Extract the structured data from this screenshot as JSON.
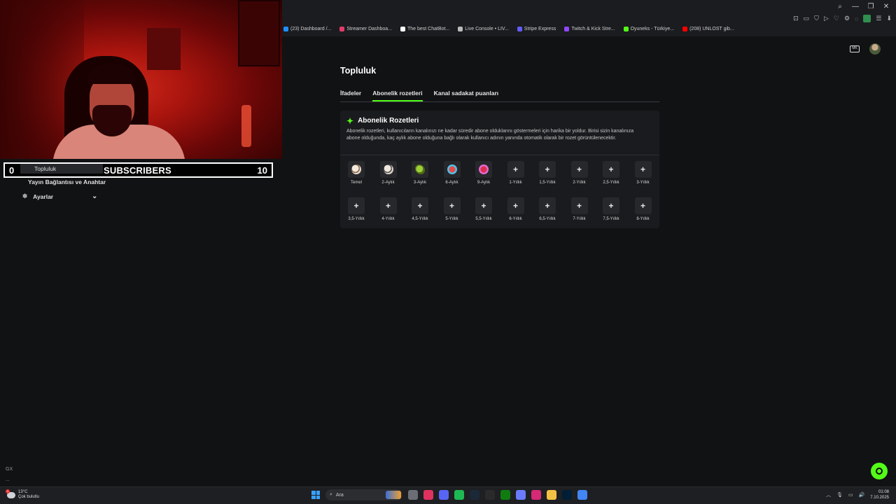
{
  "browser": {
    "bookmarks": [
      {
        "label": "(23) Dashboard /...",
        "color": "#1f8fff"
      },
      {
        "label": "Streamer Dashboa...",
        "color": "#e23b6b"
      },
      {
        "label": "The best ChatBot...",
        "color": "#ffffff"
      },
      {
        "label": "Live Console • LIV...",
        "color": "#bbbbbb"
      },
      {
        "label": "Stripe Express",
        "color": "#635bff"
      },
      {
        "label": "Twitch & Kick Stre...",
        "color": "#9147ff"
      },
      {
        "label": "Oyuneks - Türkiye...",
        "color": "#53fc18"
      },
      {
        "label": "(208) UNLOST gib...",
        "color": "#ff0000"
      }
    ],
    "extension_badge": "8"
  },
  "overlay": {
    "left_count": "0",
    "label": "SUBSCRIBERS",
    "right_count": "10",
    "covered_tab_label": "Topluluk"
  },
  "sidebar": {
    "stream_link": "Yayın Bağlantısı ve Anahtar",
    "settings_label": "Ayarlar",
    "bottom_a": "GX",
    "bottom_b": "..."
  },
  "header": {
    "icon_box_text": "MK"
  },
  "page": {
    "title": "Topluluk",
    "tabs": [
      {
        "label": "İfadeler",
        "active": false
      },
      {
        "label": "Abonelik rozetleri",
        "active": true
      },
      {
        "label": "Kanal sadakat puanları",
        "active": false
      }
    ],
    "card": {
      "title": "Abonelik Rozetleri",
      "description": "Abonelik rozetleri, kullanıcıların kanalınızı ne kadar süredir abone olduklarını göstermeleri için harika bir yoldur. Birisi sizin kanalınıza abone olduğunda, kaç aylık abone olduğuna bağlı olarak kullanıcı adının yanında otomatik olarak bir rozet görüntülenecektir."
    },
    "badges": [
      {
        "label": "Temel",
        "icon": "g1"
      },
      {
        "label": "2-Aylık",
        "icon": "g2"
      },
      {
        "label": "3-Aylık",
        "icon": "g3"
      },
      {
        "label": "6-Aylık",
        "icon": "g4"
      },
      {
        "label": "9-Aylık",
        "icon": "g5"
      },
      {
        "label": "1-Yıllık",
        "icon": "plus"
      },
      {
        "label": "1,5-Yıllık",
        "icon": "plus"
      },
      {
        "label": "2-Yıllık",
        "icon": "plus"
      },
      {
        "label": "2,5-Yıllık",
        "icon": "plus"
      },
      {
        "label": "3-Yıllık",
        "icon": "plus"
      },
      {
        "label": "3,5-Yıllık",
        "icon": "plus"
      },
      {
        "label": "4-Yıllık",
        "icon": "plus"
      },
      {
        "label": "4,5-Yıllık",
        "icon": "plus"
      },
      {
        "label": "5-Yıllık",
        "icon": "plus"
      },
      {
        "label": "5,5-Yıllık",
        "icon": "plus"
      },
      {
        "label": "6-Yıllık",
        "icon": "plus"
      },
      {
        "label": "6,5-Yıllık",
        "icon": "plus"
      },
      {
        "label": "7-Yıllık",
        "icon": "plus"
      },
      {
        "label": "7,5-Yıllık",
        "icon": "plus"
      },
      {
        "label": "8-Yıllık",
        "icon": "plus"
      }
    ],
    "plus_glyph": "+"
  },
  "taskbar": {
    "temperature": "13°C",
    "weather": "Çok bulutlu",
    "weather_alert": "1",
    "search_placeholder": "Ara",
    "time": "01:08",
    "date": "7.10.2025",
    "apps": [
      {
        "name": "file-explorer-icon",
        "color": "#6b6f75"
      },
      {
        "name": "opera-gx-icon",
        "color": "#e0325f"
      },
      {
        "name": "discord-icon",
        "color": "#5865f2"
      },
      {
        "name": "spotify-icon",
        "color": "#1db954"
      },
      {
        "name": "steam-icon",
        "color": "#1b2838"
      },
      {
        "name": "epic-games-icon",
        "color": "#2a2a2a"
      },
      {
        "name": "xbox-icon",
        "color": "#107c10"
      },
      {
        "name": "copilot-icon",
        "color": "#6a7bff"
      },
      {
        "name": "instagram-icon",
        "color": "#d62976"
      },
      {
        "name": "folder-icon",
        "color": "#f3c046"
      },
      {
        "name": "photoshop-icon",
        "color": "#001e36"
      },
      {
        "name": "chrome-icon",
        "color": "#4285f4"
      }
    ]
  },
  "colors": {
    "accent": "#53fc18",
    "background": "#111214",
    "card": "#1a1b1e"
  }
}
